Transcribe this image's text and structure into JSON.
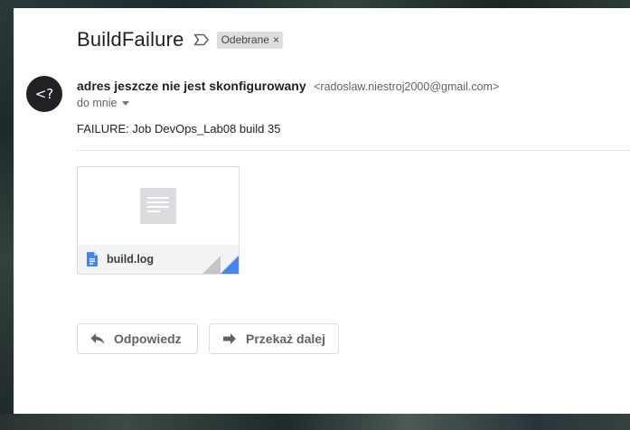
{
  "email": {
    "subject": "BuildFailure",
    "label_chip": "Odebrane",
    "label_remove_glyph": "×",
    "avatar_text": "<?",
    "sender_name": "adres jeszcze nie jest skonfigurowany",
    "sender_email": "<radoslaw.niestroj2000@gmail.com>",
    "recipient_line": "do mnie",
    "body": "FAILURE: Job DevOps_Lab08 build 35"
  },
  "attachment": {
    "file_name": "build.log",
    "preview_icon": "document-icon",
    "file_icon": "google-docs-file-icon",
    "file_icon_color": "#4285f4"
  },
  "actions": {
    "reply_label": "Odpowiedz",
    "forward_label": "Przekaż dalej"
  },
  "icons": {
    "importance": "importance-marker-icon",
    "reply": "reply-arrow-icon",
    "forward": "forward-arrow-icon",
    "recipient_details": "chevron-down-icon"
  }
}
